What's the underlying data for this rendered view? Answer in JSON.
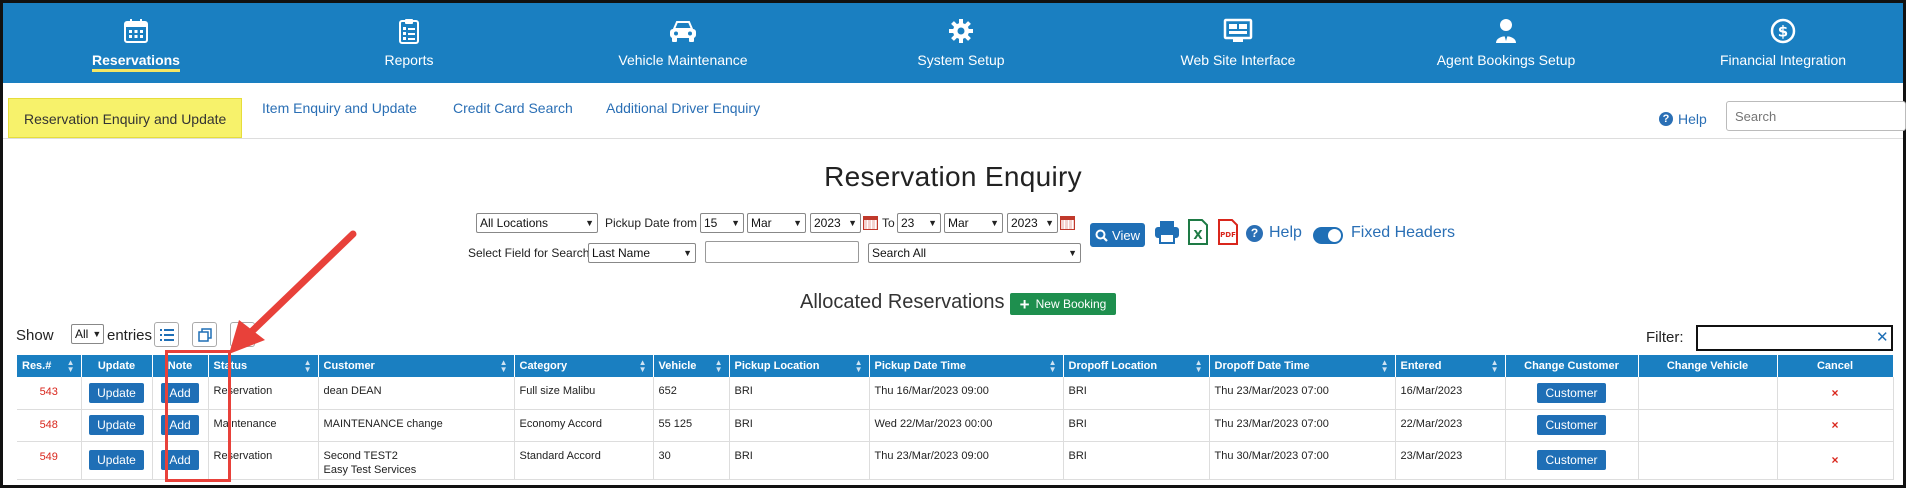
{
  "nav": {
    "items": [
      {
        "label": "Reservations",
        "icon": "calendar-icon",
        "active": true
      },
      {
        "label": "Reports",
        "icon": "clipboard-icon"
      },
      {
        "label": "Vehicle Maintenance",
        "icon": "car-icon"
      },
      {
        "label": "System Setup",
        "icon": "gear-icon"
      },
      {
        "label": "Web Site Interface",
        "icon": "monitor-icon"
      },
      {
        "label": "Agent Bookings Setup",
        "icon": "agent-icon"
      },
      {
        "label": "Financial Integration",
        "icon": "dollar-icon"
      }
    ]
  },
  "subnav": {
    "tabs": [
      {
        "label": "Reservation Enquiry and Update",
        "active": true
      },
      {
        "label": "Item Enquiry and Update"
      },
      {
        "label": "Credit Card Search"
      },
      {
        "label": "Additional Driver Enquiry"
      }
    ],
    "help_label": "Help",
    "search_placeholder": "Search"
  },
  "page": {
    "title": "Reservation Enquiry",
    "location_select": "All Locations",
    "pickup_from_label": "Pickup Date from",
    "from_day": "15",
    "from_month": "Mar",
    "from_year": "2023",
    "to_label": "To",
    "to_day": "23",
    "to_month": "Mar",
    "to_year": "2023",
    "search_field_label": "Select Field for Search",
    "search_field_select": "Last Name",
    "search_scope_select": "Search All",
    "view_label": "View",
    "help_label": "Help",
    "fixed_headers_label": "Fixed Headers",
    "allocated_title": "Allocated Reservations",
    "new_booking_label": "New Booking"
  },
  "table_controls": {
    "show_label": "Show",
    "entries_value": "All",
    "entries_label": "entries",
    "filter_label": "Filter:"
  },
  "table": {
    "headers": [
      "Res.#",
      "Update",
      "Note",
      "Status",
      "Customer",
      "Category",
      "Vehicle",
      "Pickup Location",
      "Pickup Date Time",
      "Dropoff Location",
      "Dropoff Date Time",
      "Entered",
      "Change Customer",
      "Change Vehicle",
      "Cancel"
    ],
    "rows": [
      {
        "res": "543",
        "update": "Update",
        "note": "Add",
        "status": "Reservation",
        "customer": "dean DEAN",
        "customer2": "",
        "category": "Full size Malibu",
        "vehicle": "652",
        "pickup_loc": "BRI",
        "pickup_dt": "Thu 16/Mar/2023 09:00",
        "dropoff_loc": "BRI",
        "dropoff_dt": "Thu 23/Mar/2023 07:00",
        "entered": "16/Mar/2023",
        "change_customer": "Customer",
        "cancel": "×"
      },
      {
        "res": "548",
        "update": "Update",
        "note": "Add",
        "status": "Maintenance",
        "customer": "MAINTENANCE change",
        "customer2": "",
        "category": "Economy Accord",
        "vehicle": "55 125",
        "pickup_loc": "BRI",
        "pickup_dt": "Wed 22/Mar/2023 00:00",
        "dropoff_loc": "BRI",
        "dropoff_dt": "Thu 23/Mar/2023 07:00",
        "entered": "22/Mar/2023",
        "change_customer": "Customer",
        "cancel": "×"
      },
      {
        "res": "549",
        "update": "Update",
        "note": "Add",
        "status": "Reservation",
        "customer": "Second TEST2",
        "customer2": "Easy Test Services",
        "category": "Standard Accord",
        "vehicle": "30",
        "pickup_loc": "BRI",
        "pickup_dt": "Thu 23/Mar/2023 09:00",
        "dropoff_loc": "BRI",
        "dropoff_dt": "Thu 30/Mar/2023 07:00",
        "entered": "23/Mar/2023",
        "change_customer": "Customer",
        "cancel": "×"
      }
    ]
  },
  "colors": {
    "nav_bg": "#1a7fc1",
    "active_tab_bg": "#f7f26b",
    "accent_link": "#2a6fb5",
    "new_booking_green": "#1e8f4e",
    "annotation_red": "#e8413a",
    "res_number_red": "#d9261c"
  }
}
